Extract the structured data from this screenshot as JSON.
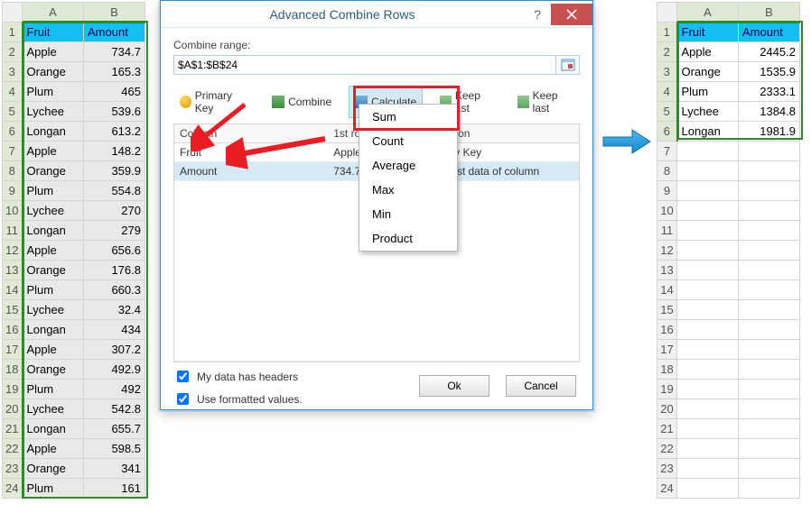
{
  "left_sheet": {
    "columns": [
      "A",
      "B"
    ],
    "header_row": [
      "Fruit",
      "Amount"
    ],
    "rows": [
      [
        "Apple",
        "734.7"
      ],
      [
        "Orange",
        "165.3"
      ],
      [
        "Plum",
        "465"
      ],
      [
        "Lychee",
        "539.6"
      ],
      [
        "Longan",
        "613.2"
      ],
      [
        "Apple",
        "148.2"
      ],
      [
        "Orange",
        "359.9"
      ],
      [
        "Plum",
        "554.8"
      ],
      [
        "Lychee",
        "270"
      ],
      [
        "Longan",
        "279"
      ],
      [
        "Apple",
        "656.6"
      ],
      [
        "Orange",
        "176.8"
      ],
      [
        "Plum",
        "660.3"
      ],
      [
        "Lychee",
        "32.4"
      ],
      [
        "Longan",
        "434"
      ],
      [
        "Apple",
        "307.2"
      ],
      [
        "Orange",
        "492.9"
      ],
      [
        "Plum",
        "492"
      ],
      [
        "Lychee",
        "542.8"
      ],
      [
        "Longan",
        "655.7"
      ],
      [
        "Apple",
        "598.5"
      ],
      [
        "Orange",
        "341"
      ],
      [
        "Plum",
        "161"
      ]
    ]
  },
  "right_sheet": {
    "columns": [
      "A",
      "B"
    ],
    "header_row": [
      "Fruit",
      "Amount"
    ],
    "rows": [
      [
        "Apple",
        "2445.2"
      ],
      [
        "Orange",
        "1535.9"
      ],
      [
        "Plum",
        "2333.1"
      ],
      [
        "Lychee",
        "1384.8"
      ],
      [
        "Longan",
        "1981.9"
      ]
    ],
    "empty_rows_from": 7,
    "empty_rows_to": 24
  },
  "dialog": {
    "title": "Advanced Combine Rows",
    "combine_range_lbl": "Combine range:",
    "combine_range_val": "$A$1:$B$24",
    "toolbar": {
      "primary_key": "Primary Key",
      "combine": "Combine",
      "calculate": "Calculate",
      "keep1st": "Keep 1st",
      "keeplast": "Keep last"
    },
    "grid": {
      "headers": [
        "Column",
        "1st row",
        "Operation"
      ],
      "row0": {
        "col": "Fruit",
        "first": "Apple",
        "op": "Primary Key"
      },
      "row1": {
        "col": "Amount",
        "first": "734.7",
        "op": "Keep 1st data of column"
      }
    },
    "chk1": "My data has headers",
    "chk2": "Use formatted values.",
    "ok": "Ok",
    "cancel": "Cancel"
  },
  "dropdown": {
    "items": [
      "Sum",
      "Count",
      "Average",
      "Max",
      "Min",
      "Product"
    ]
  }
}
